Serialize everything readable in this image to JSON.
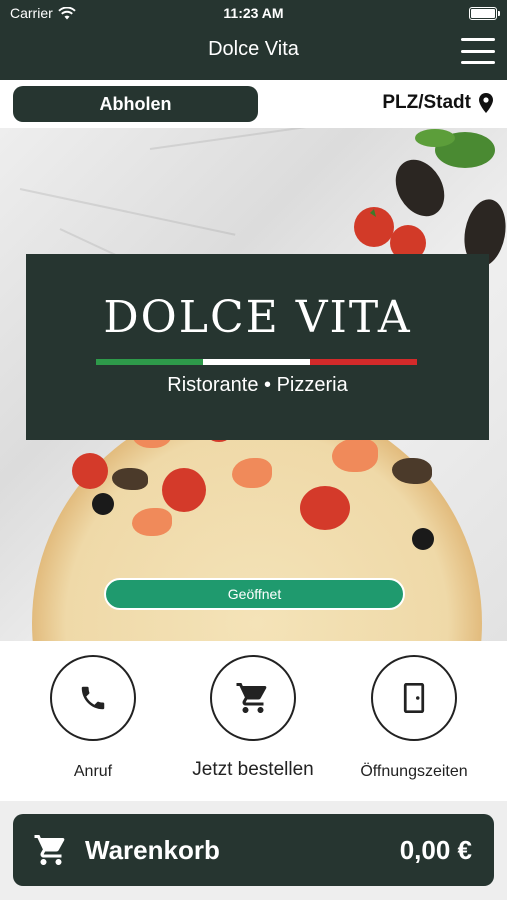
{
  "status_bar": {
    "carrier": "Carrier",
    "time": "11:23 AM"
  },
  "header": {
    "title": "Dolce Vita",
    "menu_icon": "hamburger-menu-icon"
  },
  "subbar": {
    "pickup_label": "Abholen",
    "location_label": "PLZ/Stadt",
    "location_icon": "map-pin-icon"
  },
  "hero": {
    "logo_title": "DOLCE VITA",
    "logo_subtitle": "Ristorante • Pizzeria",
    "status_label": "Geöffnet"
  },
  "actions": [
    {
      "label": "Anruf",
      "icon": "phone-icon"
    },
    {
      "label": "Jetzt bestellen",
      "icon": "cart-icon"
    },
    {
      "label": "Öffnungszeiten",
      "icon": "door-icon"
    }
  ],
  "cart": {
    "label": "Warenkorb",
    "total": "0,00 €",
    "icon": "cart-icon"
  },
  "colors": {
    "brand_dark": "#263530",
    "open_green": "#1f9a6e",
    "flag_green": "#2e9a4a",
    "flag_white": "#ffffff",
    "flag_red": "#d32a2a"
  }
}
